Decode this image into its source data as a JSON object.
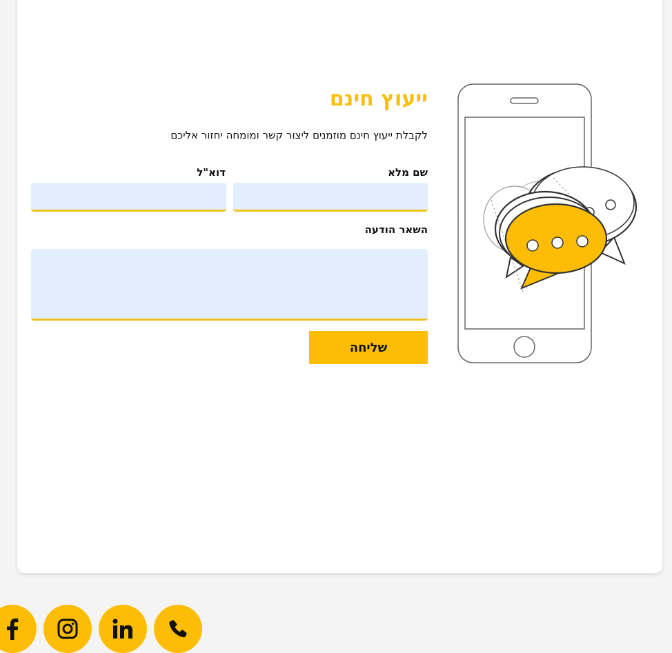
{
  "form": {
    "title": "ייעוץ חינם",
    "subtitle": "לקבלת ייעוץ חינם מוזמנים ליצור קשר ומומחה יחזור אליכם",
    "full_name_label": "שם מלא",
    "email_label": "דוא\"ל",
    "message_label": "השאר הודעה",
    "full_name_value": "",
    "email_value": "",
    "message_value": "",
    "submit_label": "שליחה"
  },
  "social_links": [
    {
      "icon": "facebook-icon"
    },
    {
      "icon": "instagram-icon"
    },
    {
      "icon": "linkedin-icon"
    },
    {
      "icon": "phone-icon"
    }
  ],
  "colors": {
    "accent": "#fcbd04",
    "title": "#f8bf0e",
    "field_bg": "#e2eefc",
    "field_underline": "#f2c21a",
    "page_bg": "#f4f4f4",
    "card_bg": "#ffffff"
  }
}
